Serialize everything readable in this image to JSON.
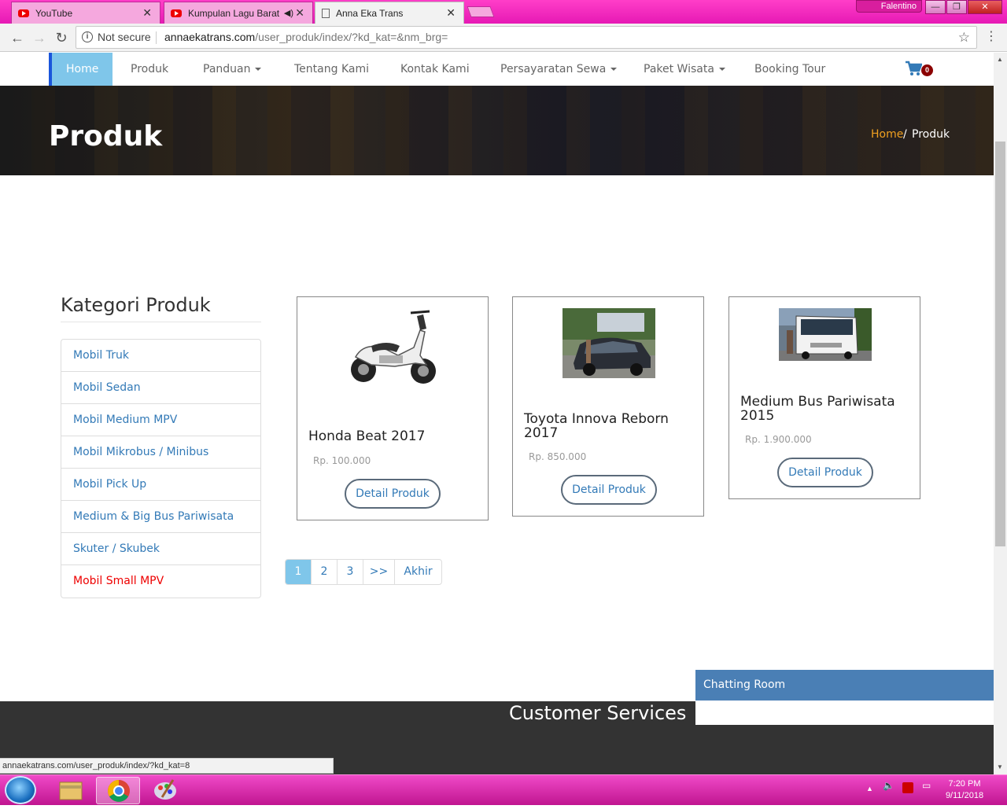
{
  "browser": {
    "tabs": [
      {
        "label": "YouTube"
      },
      {
        "label": "Kumpulan Lagu Barat"
      },
      {
        "label": "Anna Eka Trans"
      }
    ],
    "profile_name": "Falentino",
    "omnibox": {
      "security": "Not secure",
      "host": "annaekatrans.com",
      "path": "/user_produk/index/?kd_kat=&nm_brg="
    },
    "status_url": "annaekatrans.com/user_produk/index/?kd_kat=8"
  },
  "nav": {
    "items": [
      {
        "label": "Home"
      },
      {
        "label": "Produk"
      },
      {
        "label": "Panduan"
      },
      {
        "label": "Tentang Kami"
      },
      {
        "label": "Kontak Kami"
      },
      {
        "label": "Persayaratan Sewa"
      },
      {
        "label": "Paket Wisata"
      },
      {
        "label": "Booking Tour"
      }
    ],
    "cart_count": "0"
  },
  "banner": {
    "title": "Produk",
    "breadcrumb_home": "Home",
    "breadcrumb_sep": "/",
    "breadcrumb_current": "Produk"
  },
  "sidebar": {
    "title": "Kategori Produk",
    "categories": [
      {
        "label": "Mobil Truk"
      },
      {
        "label": "Mobil Sedan"
      },
      {
        "label": "Mobil Medium MPV"
      },
      {
        "label": "Mobil Mikrobus / Minibus"
      },
      {
        "label": "Mobil Pick Up"
      },
      {
        "label": "Medium & Big Bus Pariwisata"
      },
      {
        "label": "Skuter / Skubek"
      },
      {
        "label": "Mobil Small MPV"
      }
    ]
  },
  "products": [
    {
      "name": "Honda Beat 2017",
      "price": "Rp. 100.000",
      "button": "Detail Produk"
    },
    {
      "name": "Toyota Innova Reborn 2017",
      "price": "Rp. 850.000",
      "button": "Detail Produk"
    },
    {
      "name": "Medium Bus Pariwisata 2015",
      "price": "Rp. 1.900.000",
      "button": "Detail Produk"
    }
  ],
  "pagination": {
    "pages": [
      "1",
      "2",
      "3",
      ">>",
      "Akhir"
    ]
  },
  "footer": {
    "customer_services": "Customer Services",
    "chat_title": "Chatting Room"
  },
  "taskbar": {
    "time": "7:20 PM",
    "date": "9/11/2018"
  },
  "colors": {
    "accent": "#7fc6ea",
    "link": "#337ab7",
    "selected_category": "#e00000",
    "taskbar": "#e619b4"
  }
}
